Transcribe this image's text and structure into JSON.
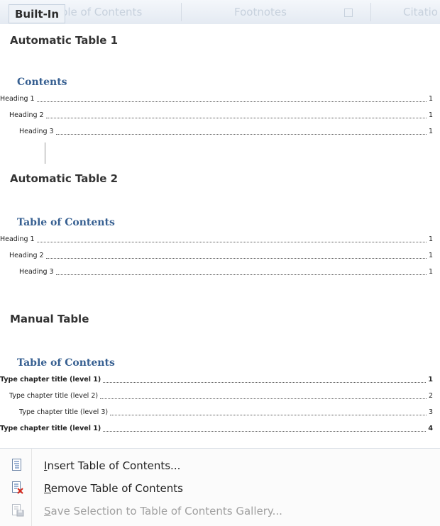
{
  "ribbon": {
    "tabs": [
      "Table of Contents",
      "Footnotes",
      "Citatio"
    ]
  },
  "gallery": {
    "header": "Built-In",
    "items": [
      {
        "label": "Automatic Table 1",
        "preview_title": "Contents",
        "entries": [
          {
            "text": "Heading 1",
            "page": "1"
          },
          {
            "text": "Heading 2",
            "page": "1"
          },
          {
            "text": "Heading 3",
            "page": "1"
          }
        ]
      },
      {
        "label": "Automatic Table 2",
        "preview_title": "Table of Contents",
        "entries": [
          {
            "text": "Heading 1",
            "page": "1"
          },
          {
            "text": "Heading 2",
            "page": "1"
          },
          {
            "text": "Heading 3",
            "page": "1"
          }
        ]
      },
      {
        "label": "Manual Table",
        "preview_title": "Table of Contents",
        "entries": [
          {
            "text": "Type chapter title (level 1)",
            "page": "1"
          },
          {
            "text": "Type chapter title (level 2)",
            "page": "2"
          },
          {
            "text": "Type chapter title (level 3)",
            "page": "3"
          },
          {
            "text": "Type chapter title (level 1)",
            "page": "4"
          }
        ]
      }
    ]
  },
  "menu": {
    "insert": {
      "hotkey": "I",
      "rest": "nsert Table of Contents...",
      "icon": "insert-toc-icon"
    },
    "remove": {
      "hotkey": "R",
      "rest": "emove Table of Contents",
      "icon": "remove-toc-icon"
    },
    "save": {
      "hotkey": "S",
      "rest": "ave Selection to Table of Contents Gallery...",
      "icon": "save-to-gallery-icon"
    }
  }
}
